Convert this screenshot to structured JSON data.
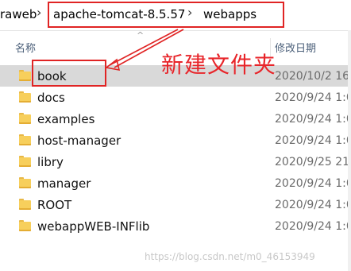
{
  "address_bar": {
    "crumbs": [
      "raweb",
      "apache-tomcat-8.5.57",
      "webapps"
    ],
    "separator": "›"
  },
  "columns": {
    "name": "名称",
    "modified": "修改日期",
    "sort_indicator": "^"
  },
  "files": [
    {
      "name": "book",
      "date": "2020/10/2 16",
      "selected": true
    },
    {
      "name": "docs",
      "date": "2020/9/24 1:0"
    },
    {
      "name": "examples",
      "date": "2020/9/24 1:0"
    },
    {
      "name": "host-manager",
      "date": "2020/9/24 1:0"
    },
    {
      "name": "libry",
      "date": "2020/9/25 21"
    },
    {
      "name": "manager",
      "date": "2020/9/24 1:0"
    },
    {
      "name": "ROOT",
      "date": "2020/9/24 1:0"
    },
    {
      "name": "webappWEB-INFlib",
      "date": "2020/9/24 1:0"
    }
  ],
  "annotation": {
    "text": "新建文件夹",
    "color": "#e8252a"
  },
  "watermark": "https://blog.csdn.net/m0_46153949",
  "icons": {
    "folder": "folder-icon"
  }
}
